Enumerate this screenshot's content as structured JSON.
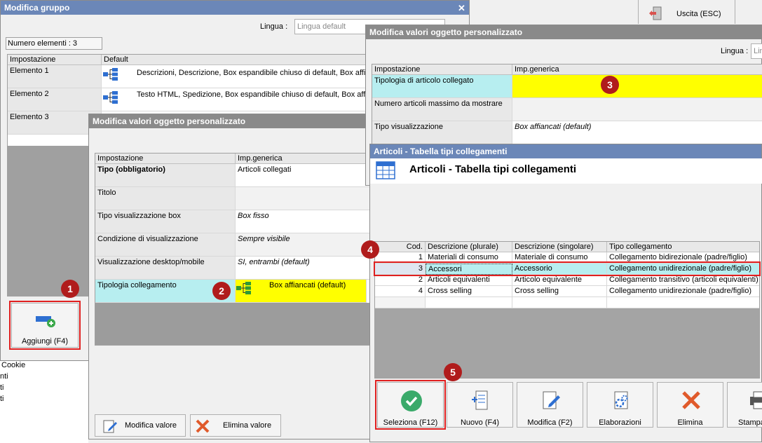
{
  "topbar": {
    "exit_label": "Uscita (ESC)"
  },
  "w1": {
    "title": "Modifica gruppo",
    "lingua_label": "Lingua :",
    "lingua_placeholder": "Lingua default",
    "count": "Numero elementi : 3",
    "col_setting": "Impostazione",
    "col_default": "Default",
    "rows": [
      {
        "label": "Elemento 1",
        "value": "Descrizioni, Descrizione, Box espandibile chiuso di default, Box affia"
      },
      {
        "label": "Elemento 2",
        "value": "Testo HTML, Spedizione, Box espandibile chiuso di default, Box affia"
      },
      {
        "label": "Elemento 3",
        "value": ""
      }
    ],
    "add_button": "Aggiungi (F4)",
    "badge": "1"
  },
  "bg_list": [
    "Cookie",
    "nti",
    "ti",
    "ti"
  ],
  "w2": {
    "title": "Modifica valori oggetto personalizzato",
    "col_setting": "Impostazione",
    "col_value": "Imp.generica",
    "rows": [
      {
        "label": "Tipo (obbligatorio)",
        "value": "Articoli collegati"
      },
      {
        "label": "Titolo",
        "value": ""
      },
      {
        "label": "Tipo visualizzazione box",
        "value": "Box fisso"
      },
      {
        "label": "Condizione di visualizzazione",
        "value": "Sempre visibile"
      },
      {
        "label": "Visualizzazione desktop/mobile",
        "value": "SI, entrambi (default)"
      },
      {
        "label": "Tipologia collegamento",
        "value": "Box affiancati (default)"
      }
    ],
    "badge": "2",
    "edit_button": "Modifica valore",
    "delete_button": "Elimina valore"
  },
  "w3": {
    "title": "Modifica valori oggetto personalizzato",
    "lingua_label": "Lingua :",
    "lingua_placeholder": "Lin",
    "col_setting": "Impostazione",
    "col_value": "Imp.generica",
    "rows": [
      {
        "label": "Tipologia di articolo collegato",
        "value": ""
      },
      {
        "label": "Numero articoli massimo da mostrare",
        "value": ""
      },
      {
        "label": "Tipo visualizzazione",
        "value": "Box affiancati (default)"
      }
    ],
    "badge": "3"
  },
  "w4": {
    "title": "Articoli - Tabella tipi collegamenti",
    "heading": "Articoli - Tabella tipi collegamenti",
    "columns": [
      "Cod.",
      "Descrizione (plurale)",
      "Descrizione (singolare)",
      "Tipo collegamento"
    ],
    "rows": [
      {
        "cod": "1",
        "plural": "Materiali di consumo",
        "singular": "Materiale di consumo",
        "type": "Collegamento bidirezionale (padre/figlio)"
      },
      {
        "cod": "3",
        "plural": "Accessori",
        "singular": "Accessorio",
        "type": "Collegamento unidirezionale (padre/figlio)"
      },
      {
        "cod": "2",
        "plural": "Articoli equivalenti",
        "singular": "Articolo equivalente",
        "type": "Collegamento transitivo (articoli equivalenti)"
      },
      {
        "cod": "4",
        "plural": "Cross selling",
        "singular": "Cross selling",
        "type": "Collegamento unidirezionale (padre/figlio)"
      }
    ],
    "badge4": "4",
    "badge5": "5",
    "buttons": [
      "Seleziona (F12)",
      "Nuovo (F4)",
      "Modifica (F2)",
      "Elaborazioni",
      "Elimina",
      "Stampa"
    ]
  }
}
